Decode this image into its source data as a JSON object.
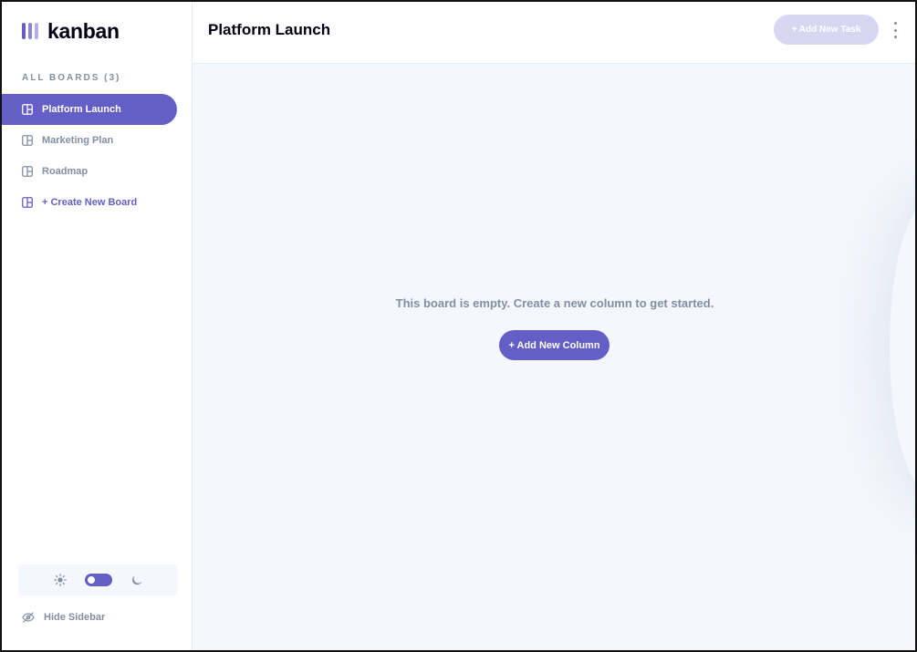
{
  "app": {
    "logo_text": "kanban",
    "accent_color": "#635fc7"
  },
  "sidebar": {
    "heading": "ALL BOARDS (3)",
    "boards": [
      {
        "label": "Platform Launch",
        "active": true,
        "icon": "board-icon"
      },
      {
        "label": "Marketing Plan",
        "active": false,
        "icon": "board-icon"
      },
      {
        "label": "Roadmap",
        "active": false,
        "icon": "board-icon"
      }
    ],
    "create_label": "+ Create New Board",
    "theme": {
      "light_icon": "sun-icon",
      "dark_icon": "moon-icon",
      "mode": "dark-toggle"
    },
    "hide_label": "Hide Sidebar"
  },
  "header": {
    "title": "Platform Launch",
    "add_task_label": "+ Add New Task",
    "menu_icon": "vertical-ellipsis-icon"
  },
  "main": {
    "empty_message": "This board is empty. Create a new column to get started.",
    "add_column_label": "+ Add New Column"
  }
}
